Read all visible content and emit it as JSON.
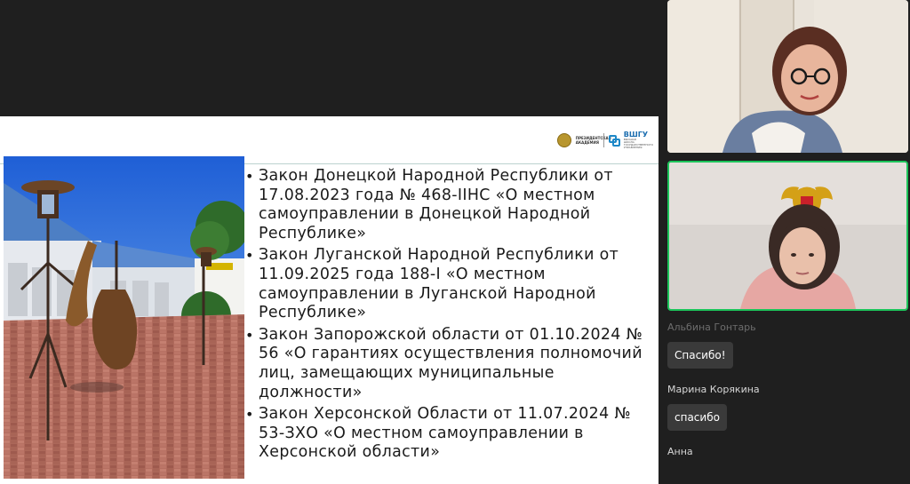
{
  "slide": {
    "logo": {
      "academy_text": "ПРЕЗИДЕНТСКАЯ АКАДЕМИЯ",
      "university_name": "ВШГУ",
      "university_subtitle": "ВЫСШАЯ ШКОЛА ГОСУДАРСТВЕННОГО УПРАВЛЕНИЯ"
    },
    "photo_description_icon": "street-sculpture-photo",
    "bullets": [
      "Закон Донецкой Народной Республики от 17.08.2023 года № 468-IIНС «О местном самоуправлении в Донецкой Народной Республике»",
      "Закон Луганской Народной Республики от 11.09.2025 года 188-I «О местном самоуправлении в Луганской Народной Республике»",
      "Закон Запорожской области от 01.10.2024 № 56 «О гарантиях осуществления полномочий лиц, замещающих муниципальные должности»",
      "Закон Херсонской Области от 11.07.2024 № 53-ЗХО «О местном самоуправлении в Херсонской области»"
    ]
  },
  "participants": {
    "tiles": [
      {
        "icon": "participant-video-woman-glasses",
        "active_speaker": false
      },
      {
        "icon": "participant-video-woman-emblem",
        "active_speaker": true,
        "border_color": "#1cc45a"
      }
    ]
  },
  "chat": {
    "messages": [
      {
        "sender": "Альбина Гонтарь",
        "text": "Спасибо!"
      },
      {
        "sender": "Марина Корякина",
        "text": "спасибо"
      },
      {
        "sender": "Анна",
        "text": ""
      }
    ]
  }
}
